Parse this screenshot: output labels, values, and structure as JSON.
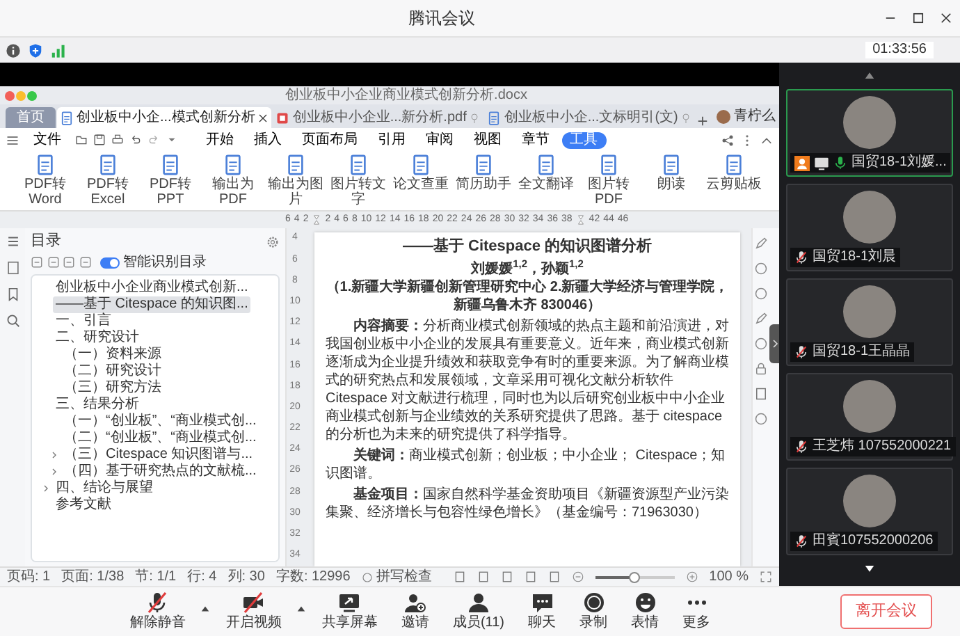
{
  "window": {
    "title": "腾讯会议"
  },
  "info_bar": {
    "timer": "01:33:56"
  },
  "shared_screen": {
    "doc_title": "创业板中小企业商业模式创新分析.docx",
    "tabs": [
      {
        "label": "首页",
        "kind": "home",
        "selected": false
      },
      {
        "label": "创业板中小企...模式创新分析",
        "kind": "doc",
        "selected": true
      },
      {
        "label": "创业板中小企业...新分析.pdf",
        "kind": "pdf",
        "selected": false
      },
      {
        "label": "创业板中小企...文标明引(文)",
        "kind": "doc",
        "selected": false
      }
    ],
    "user": "青柠么",
    "file_menu": "文件",
    "ribbon_tabs": [
      {
        "label": "开始",
        "selected": false
      },
      {
        "label": "插入",
        "selected": false
      },
      {
        "label": "页面布局",
        "selected": false
      },
      {
        "label": "引用",
        "selected": false
      },
      {
        "label": "审阅",
        "selected": false
      },
      {
        "label": "视图",
        "selected": false
      },
      {
        "label": "章节",
        "selected": false
      },
      {
        "label": "工具",
        "selected": true
      }
    ],
    "tools": [
      "PDF转Word",
      "PDF转Excel",
      "PDF转PPT",
      "输出为PDF",
      "输出为图片",
      "图片转文字",
      "论文查重",
      "简历助手",
      "全文翻译",
      "图片转PDF",
      "朗读",
      "云剪贴板"
    ],
    "ruler_numbers": [
      "6",
      "4",
      "2",
      "2",
      "4",
      "6",
      "8",
      "10",
      "12",
      "14",
      "16",
      "18",
      "20",
      "22",
      "24",
      "26",
      "28",
      "30",
      "32",
      "34",
      "36",
      "38",
      "42",
      "44",
      "46"
    ],
    "vertical_ruler_numbers": [
      "4",
      "6",
      "8",
      "10",
      "12",
      "14",
      "16",
      "18",
      "20",
      "22",
      "24",
      "26",
      "28",
      "30",
      "32",
      "34"
    ],
    "toc": {
      "title": "目录",
      "smart_toggle": {
        "label": "智能识别目录",
        "on": true
      },
      "items": [
        {
          "label": "创业板中小企业商业模式创新...",
          "selected": false,
          "collapsed": false
        },
        {
          "label": "——基于 Citespace 的知识图...",
          "selected": true,
          "collapsed": false
        },
        {
          "label": "一、引言",
          "selected": false,
          "collapsed": false
        },
        {
          "label": "二、研究设计",
          "selected": false,
          "collapsed": false,
          "children": [
            {
              "label": "（一）资料来源",
              "selected": false,
              "collapsed": false
            },
            {
              "label": "（二）研究设计",
              "selected": false,
              "collapsed": false
            },
            {
              "label": "（三）研究方法",
              "selected": false,
              "collapsed": false
            }
          ]
        },
        {
          "label": "三、结果分析",
          "selected": false,
          "collapsed": false,
          "children": [
            {
              "label": "（一）“创业板”、“商业模式创...",
              "selected": false,
              "collapsed": false
            },
            {
              "label": "（二）“创业板”、“商业模式创...",
              "selected": false,
              "collapsed": false
            },
            {
              "label": "（三）Citespace 知识图谱与...",
              "selected": false,
              "collapsed": true
            },
            {
              "label": "（四）基于研究热点的文献梳...",
              "selected": false,
              "collapsed": true
            }
          ]
        },
        {
          "label": "四、结论与展望",
          "selected": false,
          "collapsed": true
        },
        {
          "label": "参考文献",
          "selected": false,
          "collapsed": false
        }
      ]
    },
    "document": {
      "subtitle": "——基于 Citespace 的知识图谱分析",
      "authors": "刘媛媛$^{1,2}$，孙颖$^{1,2}$",
      "affiliation": "（1.新疆大学新疆创新管理研究中心 2.新疆大学经济与管理学院，新疆乌鲁木齐 830046）",
      "paragraphs": [
        "**内容摘要：**分析商业模式创新领域的热点主题和前沿演进，对我国创业板中小企业的发展具有重要意义。近年来，商业模式创新逐渐成为企业提升绩效和获取竞争有时的重要来源。为了解商业模式的研究热点和发展领域，文章采用可视化文献分析软件 Citespace 对文献进行梳理，同时也为以后研究创业板中中小企业商业模式创新与企业绩效的关系研究提供了思路。基于 citespace 的分析也为未来的研究提供了科学指导。",
        "**关键词：**商业模式创新；创业板；中小企业； Citespace；知识图谱。",
        "**基金项目：**国家自然科学基金资助项目《新疆资源型产业污染集聚、经济增长与包容性绿色增长》（基金编号：71963030）"
      ]
    },
    "status_bar": {
      "items": [
        "页码: 1",
        "页面: 1/38",
        "节: 1/1",
        "行: 4",
        "列: 30",
        "字数: 12996"
      ],
      "spell_check": "拼写检查",
      "zoom": {
        "level": 0.5,
        "reading": "100 %"
      }
    }
  },
  "participants": [
    {
      "name": "国贸18-1刘媛...",
      "selected": true,
      "host": true,
      "sharing": true,
      "muted": false
    },
    {
      "name": "国贸18-1刘晨",
      "selected": false,
      "host": false,
      "sharing": false,
      "muted": true
    },
    {
      "name": "国贸18-1王晶晶",
      "selected": false,
      "host": false,
      "sharing": false,
      "muted": true
    },
    {
      "name": "王芝炜 107552000221",
      "selected": false,
      "host": false,
      "sharing": false,
      "muted": true
    },
    {
      "name": "田賓107552000206",
      "selected": false,
      "host": false,
      "sharing": false,
      "muted": true
    }
  ],
  "toolbar": {
    "buttons": [
      {
        "label": "解除静音",
        "kind": "mic",
        "crossed": true,
        "caret": true
      },
      {
        "label": "开启视频",
        "kind": "camera",
        "crossed": true,
        "caret": true
      },
      {
        "label": "共享屏幕",
        "kind": "share",
        "crossed": false,
        "caret": false
      },
      {
        "label": "邀请",
        "kind": "invite",
        "crossed": false,
        "caret": false
      },
      {
        "label": "成员(11)",
        "kind": "members",
        "crossed": false,
        "caret": false
      },
      {
        "label": "聊天",
        "kind": "chat",
        "crossed": false,
        "caret": false
      },
      {
        "label": "录制",
        "kind": "record",
        "crossed": false,
        "caret": false
      },
      {
        "label": "表情",
        "kind": "emoji",
        "crossed": false,
        "caret": false
      },
      {
        "label": "更多",
        "kind": "more",
        "crossed": false,
        "caret": false
      }
    ],
    "leave": "离开会议"
  }
}
